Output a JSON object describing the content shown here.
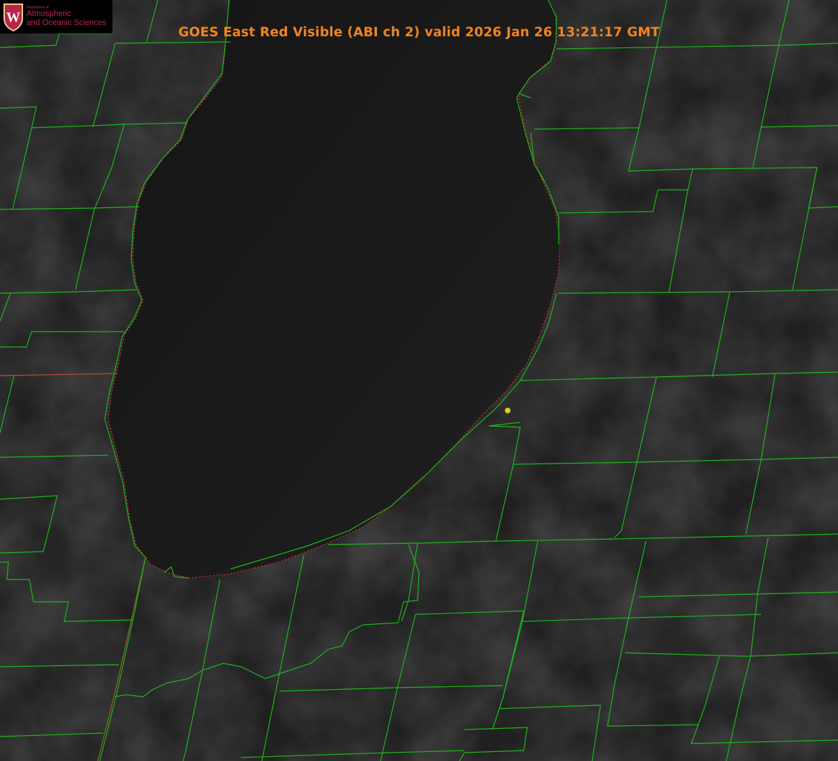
{
  "header": {
    "title": "GOES East Red Visible (ABI ch 2) valid 2026 Jan 26 13:21:17 GMT"
  },
  "logo": {
    "line_small": "Department of",
    "line1": "Atmospheric",
    "line2": "and Oceanic Sciences",
    "crest_letter": "W",
    "crest_color": "#b8264a"
  },
  "map": {
    "background_color": "#1f1f1f",
    "lake_color": "#181818",
    "county_border_color": "#1db81d",
    "shoreline_color": "#e0282a",
    "marker_color": "#d4d41a"
  }
}
